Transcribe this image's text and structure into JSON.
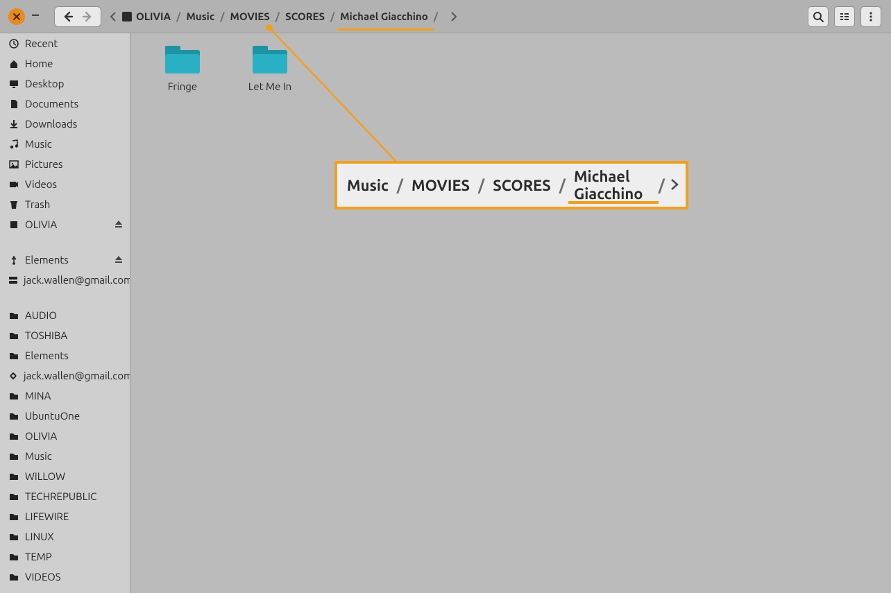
{
  "breadcrumb": {
    "root": "OLIVIA",
    "seg1": "Music",
    "seg2": "MOVIES",
    "seg3": "SCORES",
    "seg4": "Michael Giacchino"
  },
  "sidebar": {
    "recent": "Recent",
    "home": "Home",
    "desktop": "Desktop",
    "documents": "Documents",
    "downloads": "Downloads",
    "music": "Music",
    "pictures": "Pictures",
    "videos": "Videos",
    "trash": "Trash",
    "olivia": "OLIVIA",
    "elements": "Elements",
    "gmail": "jack.wallen@gmail.com",
    "bm_audio": "AUDIO",
    "bm_toshiba": "TOSHIBA",
    "bm_elements": "Elements",
    "bm_gmail": "jack.wallen@gmail.com",
    "bm_mina": "MINA",
    "bm_ubuntu": "UbuntuOne",
    "bm_olivia": "OLIVIA",
    "bm_music": "Music",
    "bm_willow": "WILLOW",
    "bm_techrep": "TECHREPUBLIC",
    "bm_lifewire": "LIFEWIRE",
    "bm_linux": "LINUX",
    "bm_temp": "TEMP",
    "bm_videos": "VIDEOS"
  },
  "folders": {
    "f1": "Fringe",
    "f2": "Let Me In"
  },
  "zoom": {
    "z1": "Music",
    "z2": "MOVIES",
    "z3": "SCORES",
    "z4": "Michael Giacchino"
  }
}
